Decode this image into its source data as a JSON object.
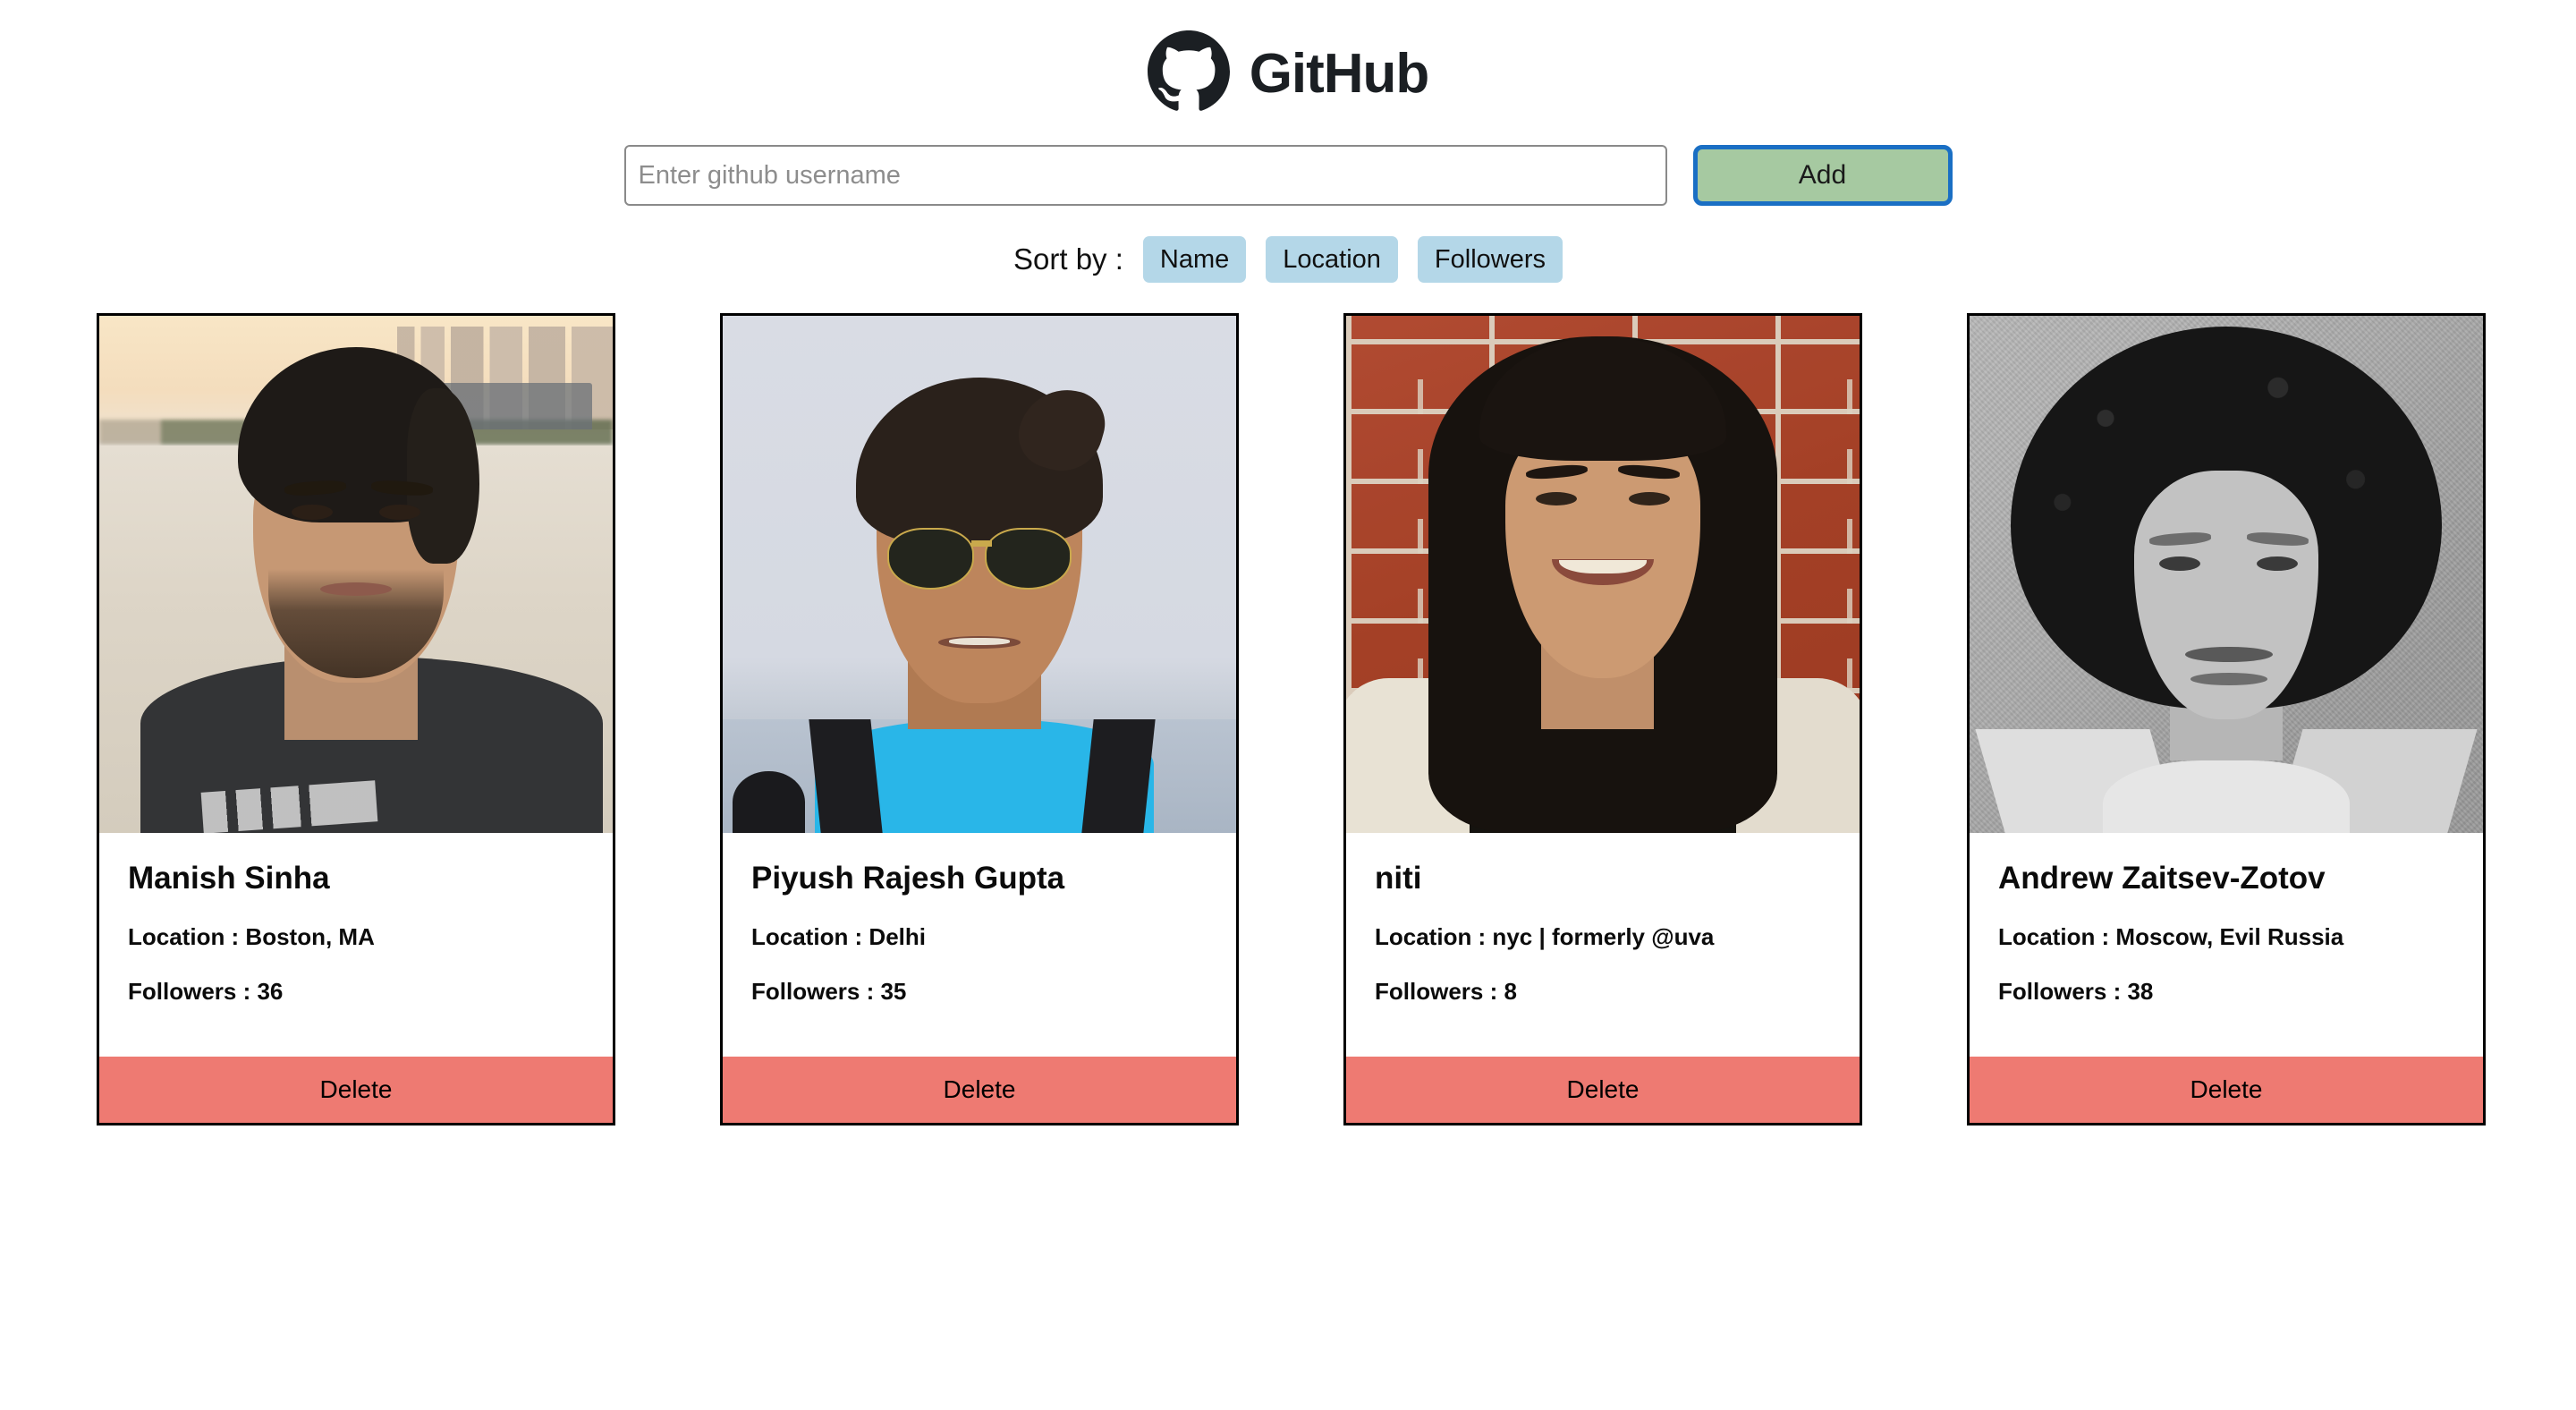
{
  "header": {
    "logo_icon": "github-octocat-icon",
    "brand": "GitHub"
  },
  "form": {
    "input_placeholder": "Enter github username",
    "input_value": "",
    "add_label": "Add",
    "add_bg_color": "#a6c9a1",
    "add_focus_ring_color": "#1a6fc4"
  },
  "sort": {
    "label": "Sort by :",
    "button_bg_color": "#b4d7e8",
    "buttons": [
      {
        "label": "Name"
      },
      {
        "label": "Location"
      },
      {
        "label": "Followers"
      }
    ]
  },
  "cards": {
    "location_prefix": "Location : ",
    "followers_prefix": "Followers : ",
    "delete_label": "Delete",
    "delete_bg_color": "#ee7a72",
    "items": [
      {
        "name": "Manish Sinha",
        "location_line": "Location : Boston, MA",
        "followers_line": "Followers : 36",
        "avatar_alt": "beach-selfie-portrait"
      },
      {
        "name": "Piyush Rajesh Gupta",
        "location_line": "Location : Delhi",
        "followers_line": "Followers : 35",
        "avatar_alt": "sunglasses-portrait"
      },
      {
        "name": "niti",
        "location_line": "Location : nyc | formerly @uva",
        "followers_line": "Followers : 8",
        "avatar_alt": "brick-wall-portrait"
      },
      {
        "name": "Andrew Zaitsev-Zotov",
        "location_line": "Location : Moscow, Evil Russia",
        "followers_line": "Followers : 38",
        "avatar_alt": "black-and-white-afro-portrait"
      }
    ]
  }
}
